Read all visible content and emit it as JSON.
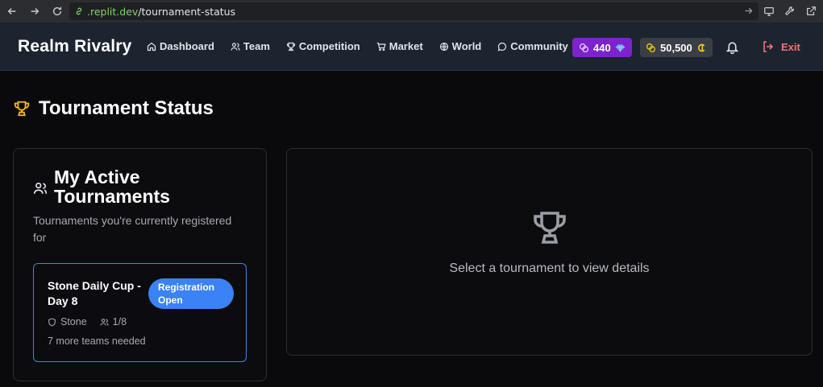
{
  "browser": {
    "url_host": ".replit.dev",
    "url_path": "/tournament-status"
  },
  "header": {
    "brand": "Realm Rivalry",
    "nav": [
      {
        "label": "Dashboard",
        "icon": "home-icon"
      },
      {
        "label": "Team",
        "icon": "users-icon"
      },
      {
        "label": "Competition",
        "icon": "trophy-icon"
      },
      {
        "label": "Market",
        "icon": "cart-icon"
      },
      {
        "label": "World",
        "icon": "globe-icon"
      },
      {
        "label": "Community",
        "icon": "chat-icon"
      }
    ],
    "gems": "440",
    "coins": "50,500",
    "exit_label": "Exit"
  },
  "page": {
    "title": "Tournament Status"
  },
  "active": {
    "title": "My Active Tournaments",
    "subtitle": "Tournaments you're currently registered for",
    "tournament": {
      "name": "Stone Daily Cup - Day 8",
      "status": "Registration Open",
      "division": "Stone",
      "teams": "1/8",
      "needed": "7 more teams needed"
    }
  },
  "details": {
    "empty_text": "Select a tournament to view details"
  },
  "colors": {
    "accent_blue": "#3b82f6",
    "gems_purple": "#7e22ce",
    "trophy_gold": "#f5b81a",
    "exit_red": "#f87171"
  }
}
